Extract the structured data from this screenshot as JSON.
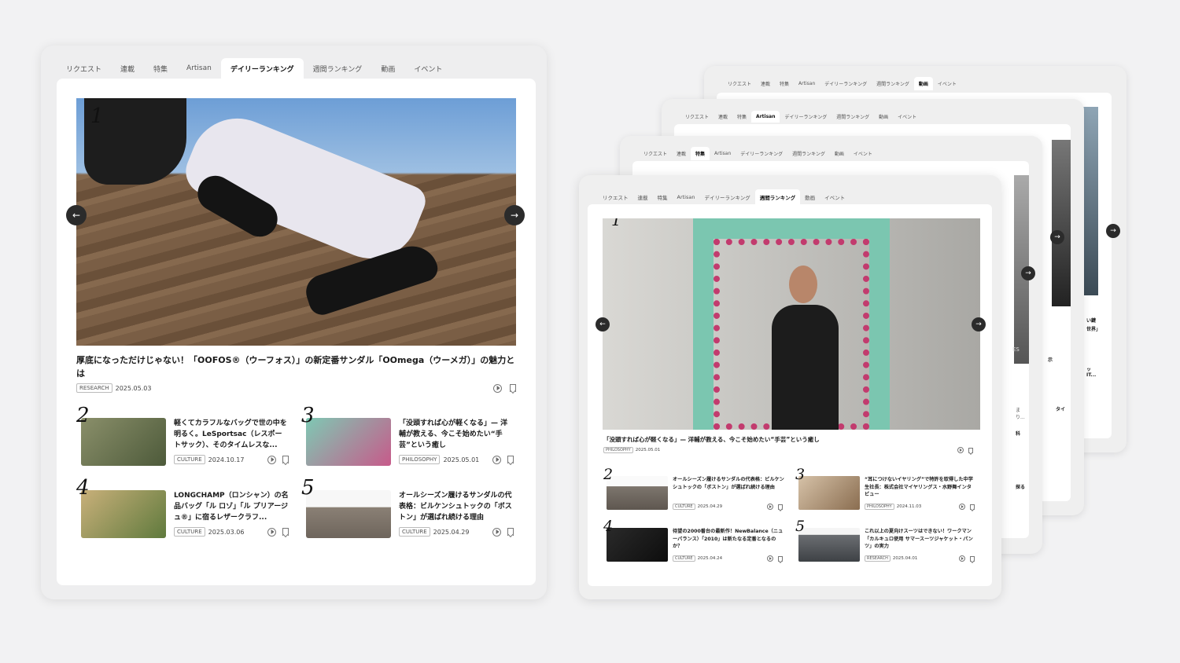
{
  "tabs": [
    "リクエスト",
    "連載",
    "特集",
    "Artisan",
    "デイリーランキング",
    "週間ランキング",
    "動画",
    "イベント"
  ],
  "colors": {
    "background": "#f2f2f3",
    "arrow": "#2b2b2b",
    "panel": "#eeeeef"
  },
  "icons": {
    "prev": "←",
    "next": "→",
    "play": "play-circle-icon",
    "bookmark": "bookmark-icon"
  },
  "main": {
    "active_tab": "デイリーランキング",
    "hero": {
      "rank": "1",
      "title": "厚底になっただけじゃない！「OOFOS®（ウーフォス）」の新定番サンダル「OOmega（ウーメガ）」の魅力とは",
      "tag": "RESEARCH",
      "date": "2025.05.03"
    },
    "cards": [
      {
        "rank": "2",
        "title": "軽くてカラフルなバッグで世の中を明るく。LeSportsac（レスポートサック）、そのタイムレスな...",
        "tag": "CULTURE",
        "date": "2024.10.17"
      },
      {
        "rank": "3",
        "title": "「没頭すれば心が軽くなる」— 洋輔が教える、今こそ始めたい“手芸”という癒し",
        "tag": "PHILOSOPHY",
        "date": "2025.05.01"
      },
      {
        "rank": "4",
        "title": "LONGCHAMP（ロンシャン）の名品バッグ「ル ロゾ」「ル プリアージュ®」に宿るレザークラフ...",
        "tag": "CULTURE",
        "date": "2025.03.06"
      },
      {
        "rank": "5",
        "title": "オールシーズン履けるサンダルの代表格：ビルケンシュトックの「ボストン」が選ばれ続ける理由",
        "tag": "CULTURE",
        "date": "2025.04.29"
      }
    ]
  },
  "stack_panels": [
    {
      "active_tab": "動画",
      "snippets": [
        "い鍵",
        "世界」",
        "ッ",
        "IT..."
      ]
    },
    {
      "active_tab": "Artisan",
      "snippets": [
        "示",
        "タイ"
      ]
    },
    {
      "active_tab": "特集",
      "snippets": [
        "ES",
        "まり...",
        "科",
        "探る"
      ]
    }
  ],
  "front": {
    "active_tab": "週間ランキング",
    "hero": {
      "rank": "1",
      "title": "「没頭すれば心が軽くなる」— 洋輔が教える、今こそ始めたい“手芸”という癒し",
      "tag": "PHILOSOPHY",
      "date": "2025.05.01"
    },
    "cards": [
      {
        "rank": "2",
        "title": "オールシーズン履けるサンダルの代表格：ビルケンシュトックの「ボストン」が選ばれ続ける理由",
        "tag": "CULTURE",
        "date": "2025.04.29"
      },
      {
        "rank": "3",
        "title": "“耳につけないイヤリング”で特許を取得した中学生社長：株式会社マイヤリングス・水野舞インタビュー",
        "tag": "PHILOSOPHY",
        "date": "2024.11.03"
      },
      {
        "rank": "4",
        "title": "待望の2000番台の最新作！NewBalance（ニューバランス）「2010」は新たなる定番となるのか？",
        "tag": "CULTURE",
        "date": "2025.04.24"
      },
      {
        "rank": "5",
        "title": "これ以上の夏向けスーツはできない！ワークマン「カルキュロ使用 サマースーツジャケット・パンツ」の実力",
        "tag": "RESEARCH",
        "date": "2025.04.01"
      }
    ]
  }
}
